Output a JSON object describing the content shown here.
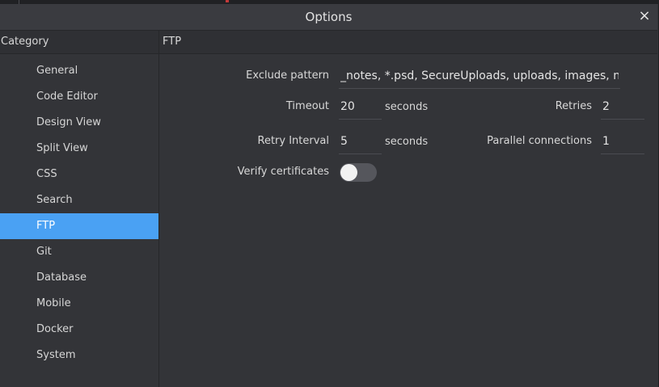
{
  "window": {
    "title": "Options",
    "close_icon": "×"
  },
  "header": {
    "category": "Category",
    "section": "FTP"
  },
  "sidebar": {
    "items": [
      {
        "label": "General"
      },
      {
        "label": "Code Editor"
      },
      {
        "label": "Design View"
      },
      {
        "label": "Split View"
      },
      {
        "label": "CSS"
      },
      {
        "label": "Search"
      },
      {
        "label": "FTP"
      },
      {
        "label": "Git"
      },
      {
        "label": "Database"
      },
      {
        "label": "Mobile"
      },
      {
        "label": "Docker"
      },
      {
        "label": "System"
      }
    ],
    "active": "FTP"
  },
  "ftp": {
    "exclude_label": "Exclude pattern",
    "exclude_value": "_notes, *.psd, SecureUploads, uploads, images, node_modules",
    "timeout_label": "Timeout",
    "timeout_value": "20",
    "timeout_unit": "seconds",
    "retries_label": "Retries",
    "retries_value": "2",
    "retry_interval_label": "Retry Interval",
    "retry_interval_value": "5",
    "retry_interval_unit": "seconds",
    "parallel_label": "Parallel connections",
    "parallel_value": "1",
    "verify_label": "Verify certificates",
    "verify_enabled": false
  },
  "colors": {
    "accent": "#4aa1f3",
    "background": "#333438"
  }
}
